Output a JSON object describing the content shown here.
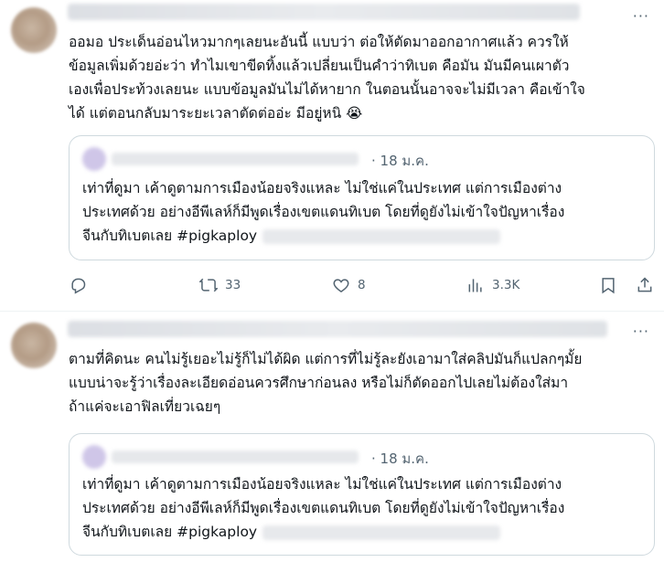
{
  "tweets": [
    {
      "text_lines": [
        "ออมอ ประเด็นอ่อนไหวมากๆเลยนะอันนี้ แบบว่า ต่อให้ตัดมาออกอากาศแล้ว ควรให้",
        "ข้อมูลเพิ่มด้วยอ่ะว่า ทำไมเขาขีดทิ้งแล้วเปลี่ยนเป็นคำว่าทิเบต คือมัน มันมีคนเผาตัว",
        "เองเพื่อประท้วงเลยนะ แบบข้อมูลมันไม่ได้หายาก ในตอนนั้นอาจจะไม่มีเวลา คือเข้าใจ",
        "ได้ แต่ตอนกลับมาระยะเวลาตัดต่ออ่ะ มีอยู่หนิ 😭"
      ],
      "quote": {
        "date": "· 18 ม.ค.",
        "lines": [
          "เท่าที่ดูมา เค้าดูตามการเมืองน้อยจริงแหละ ไม่ใช่แค่ในประเทศ แต่การเมืองต่าง",
          "ประเทศด้วย อย่างอีพีเลห์ก็มีพูดเรื่องเขตแดนทิเบต โดยที่ดูยังไม่เข้าใจปัญหาเรื่อง",
          "จีนกับทิเบตเลย #pigkaploy"
        ]
      },
      "actions": {
        "reply_count": "",
        "retweet_count": "33",
        "like_count": "8",
        "views_count": "3.3K"
      }
    },
    {
      "text_lines": [
        "ตามที่คิดนะ คนไม่รู้เยอะไม่รู้ก็ไม่ได้ผิด แต่การที่ไม่รู้ละยังเอามาใส่คลิปมันก็แปลกๆมั้ย",
        "แบบน่าจะรู้ว่าเรื่องละเอียดอ่อนควรศึกษาก่อนลง หรือไม่ก็ตัดออกไปเลยไม่ต้องใส่มา",
        "ถ้าแค่จะเอาฟิลเที่ยวเฉยๆ"
      ],
      "quote": {
        "date": "· 18 ม.ค.",
        "lines": [
          "เท่าที่ดูมา เค้าดูตามการเมืองน้อยจริงแหละ ไม่ใช่แค่ในประเทศ แต่การเมืองต่าง",
          "ประเทศด้วย อย่างอีพีเลห์ก็มีพูดเรื่องเขตแดนทิเบต โดยที่ดูยังไม่เข้าใจปัญหาเรื่อง",
          "จีนกับทิเบตเลย #pigkaploy"
        ]
      }
    }
  ],
  "more_label": "···"
}
